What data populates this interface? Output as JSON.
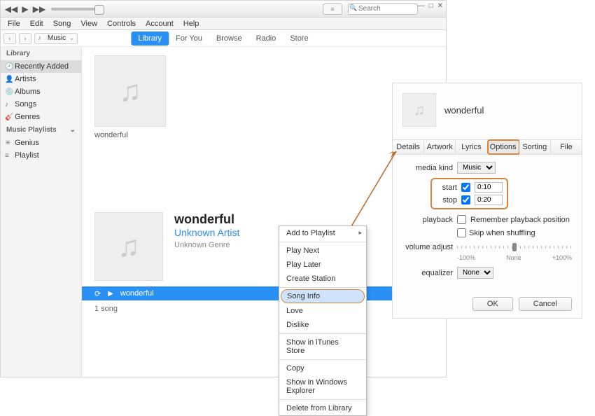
{
  "menubar": [
    "File",
    "Edit",
    "Song",
    "View",
    "Controls",
    "Account",
    "Help"
  ],
  "search": {
    "placeholder": "Search"
  },
  "nav": {
    "selector": "Music"
  },
  "tabs": [
    "Library",
    "For You",
    "Browse",
    "Radio",
    "Store"
  ],
  "sidebar": {
    "library_hdr": "Library",
    "library": [
      {
        "icon": "🕘",
        "label": "Recently Added"
      },
      {
        "icon": "👤",
        "label": "Artists"
      },
      {
        "icon": "💿",
        "label": "Albums"
      },
      {
        "icon": "♪",
        "label": "Songs"
      },
      {
        "icon": "🎸",
        "label": "Genres"
      }
    ],
    "playlists_hdr": "Music Playlists",
    "playlists": [
      {
        "icon": "✳",
        "label": "Genius"
      },
      {
        "icon": "≡",
        "label": "Playlist"
      }
    ]
  },
  "album": {
    "name": "wonderful"
  },
  "song": {
    "title": "wonderful",
    "artist": "Unknown Artist",
    "genre": "Unknown Genre",
    "now_playing": "wonderful",
    "count": "1 song"
  },
  "ctx": {
    "add": "Add to Playlist",
    "playnext": "Play Next",
    "playlater": "Play Later",
    "station": "Create Station",
    "songinfo": "Song Info",
    "love": "Love",
    "dislike": "Dislike",
    "showstore": "Show in iTunes Store",
    "copy": "Copy",
    "showexp": "Show in Windows Explorer",
    "delete": "Delete from Library"
  },
  "dialog": {
    "title": "wonderful",
    "tabs": [
      "Details",
      "Artwork",
      "Lyrics",
      "Options",
      "Sorting",
      "File"
    ],
    "media_kind_label": "media kind",
    "media_kind": "Music",
    "start_label": "start",
    "start": "0:10",
    "stop_label": "stop",
    "stop": "0:20",
    "playback_label": "playback",
    "remember": "Remember playback position",
    "skip": "Skip when shuffling",
    "vol_label": "volume adjust",
    "vol_min": "-100%",
    "vol_mid": "None",
    "vol_max": "+100%",
    "eq_label": "equalizer",
    "eq": "None",
    "ok": "OK",
    "cancel": "Cancel"
  }
}
